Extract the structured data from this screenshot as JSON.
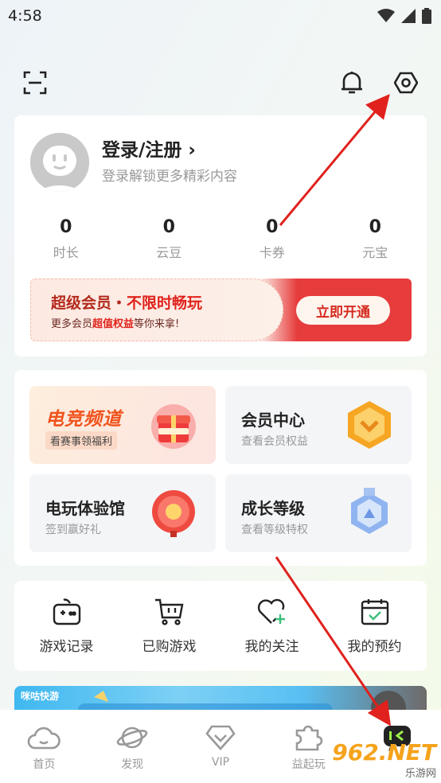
{
  "status_bar": {
    "time": "4:58"
  },
  "profile": {
    "login_label": "登录/注册 ›",
    "login_subtitle": "登录解锁更多精彩内容",
    "stats": [
      {
        "value": "0",
        "label": "时长"
      },
      {
        "value": "0",
        "label": "云豆"
      },
      {
        "value": "0",
        "label": "卡券"
      },
      {
        "value": "0",
        "label": "元宝"
      }
    ]
  },
  "vip_banner": {
    "title_part1": "超级会员・",
    "title_part2": "不限时畅玩",
    "desc_part1": "更多会员",
    "desc_accent": "超值权益",
    "desc_part2": "等你来拿!",
    "button_label": "立即开通"
  },
  "features": [
    {
      "title": "电竞频道",
      "subtitle": "看赛事领福利"
    },
    {
      "title": "会员中心",
      "subtitle": "查看会员权益"
    },
    {
      "title": "电玩体验馆",
      "subtitle": "签到赢好礼"
    },
    {
      "title": "成长等级",
      "subtitle": "查看等级特权"
    }
  ],
  "shortcuts": [
    {
      "label": "游戏记录",
      "icon": "gamepad-icon"
    },
    {
      "label": "已购游戏",
      "icon": "cart-icon"
    },
    {
      "label": "我的关注",
      "icon": "heart-plus-icon"
    },
    {
      "label": "我的预约",
      "icon": "calendar-check-icon"
    }
  ],
  "banner": {
    "logo_text": "咪咕快游"
  },
  "bottom_nav": [
    {
      "label": "首页",
      "icon": "cloud-icon"
    },
    {
      "label": "发现",
      "icon": "planet-icon"
    },
    {
      "label": "VIP",
      "icon": "diamond-icon"
    },
    {
      "label": "益起玩",
      "icon": "puzzle-icon"
    },
    {
      "label": "",
      "icon": "profile-chat-icon"
    }
  ],
  "watermark": {
    "main": "962.NET",
    "sub": "乐游网"
  },
  "colors": {
    "accent_red": "#d52a1e",
    "arrow_red": "#e0211d",
    "esports_orange": "#f0531c"
  }
}
